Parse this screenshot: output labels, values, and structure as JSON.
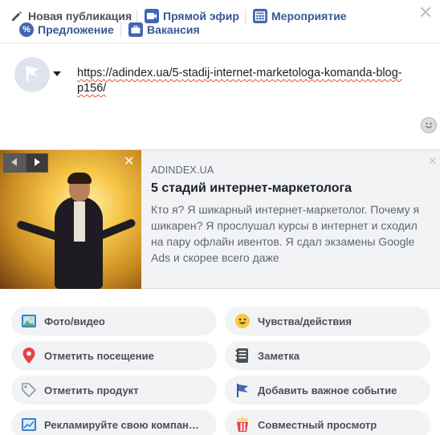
{
  "tabs": {
    "new_post": "Новая публикация",
    "live": "Прямой эфир",
    "event": "Мероприятие",
    "offer": "Предложение",
    "job": "Вакансия"
  },
  "composer": {
    "text": "https://adindex.ua/5-stadij-internet-marketologa-komanda-blog-p156/"
  },
  "preview": {
    "domain": "ADINDEX.UA",
    "title": "5 стадий интернет-маркетолога",
    "description": "Кто я? Я шикарный интернет-маркетолог. Почему я шикарен? Я прослушал курсы в интернет и сходил на пару офлайн ивентов. Я сдал экзамены Google Ads и скорее всего даже"
  },
  "actions": [
    {
      "label": "Фото/видео",
      "icon": "photo-icon"
    },
    {
      "label": "Чувства/действия",
      "icon": "smiley-icon"
    },
    {
      "label": "Отметить посещение",
      "icon": "location-pin-icon"
    },
    {
      "label": "Заметка",
      "icon": "note-icon"
    },
    {
      "label": "Отметить продукт",
      "icon": "tag-icon"
    },
    {
      "label": "Добавить важное событие",
      "icon": "flag-icon"
    },
    {
      "label": "Рекламируйте свою компан…",
      "icon": "promote-icon"
    },
    {
      "label": "Совместный просмотр",
      "icon": "popcorn-icon"
    }
  ],
  "colors": {
    "fb_blue": "#4267b2",
    "action_bg": "#f2f3f5"
  }
}
